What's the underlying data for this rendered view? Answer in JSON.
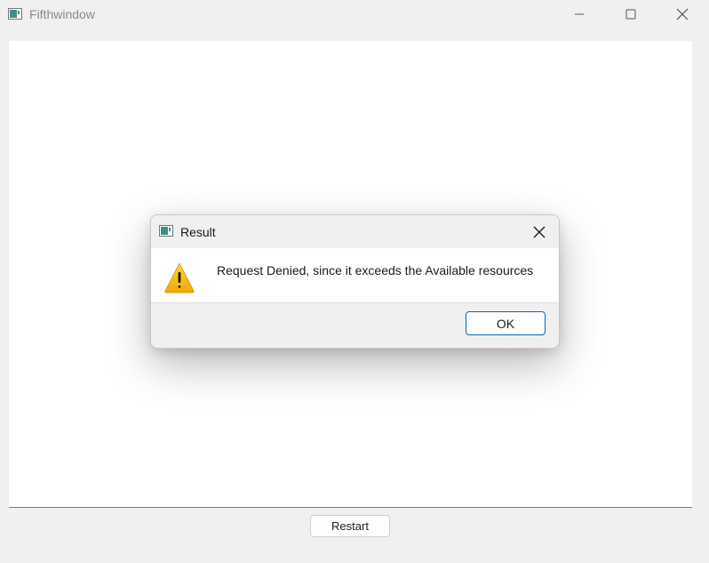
{
  "window": {
    "title": "Fifthwindow",
    "icon": "app-window-icon",
    "controls": [
      "minimize-icon",
      "maximize-icon",
      "close-icon"
    ]
  },
  "main": {
    "restart_label": "Restart"
  },
  "dialog": {
    "title": "Result",
    "icon": "app-window-icon",
    "message_icon": "warning-icon",
    "message": "Request Denied, since it exceeds the Available resources",
    "ok_label": "OK",
    "accent_color": "#0067c0",
    "warning_color": "#f4b400"
  }
}
